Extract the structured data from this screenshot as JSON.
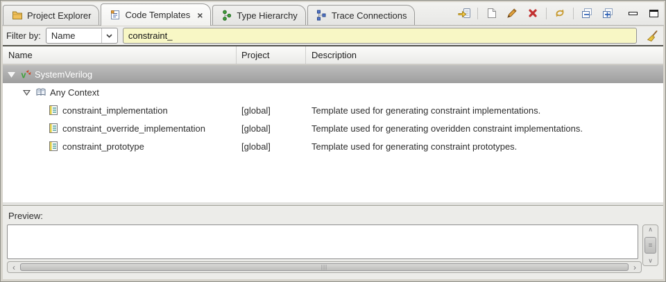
{
  "colors": {
    "filter_input_bg": "#f8f7c5",
    "selection_top": "#bdbdbd",
    "selection_bottom": "#9e9e9e",
    "delete_red": "#c23030",
    "pencil_orange": "#e0a23c",
    "refresh_gold": "#c79a2e",
    "hierarchy_green": "#44a03c",
    "hierarchy_blue": "#5577cc",
    "folder_yellow": "#f0c05a"
  },
  "tabs": {
    "items": [
      {
        "label": "Project Explorer"
      },
      {
        "label": "Code Templates"
      },
      {
        "label": "Type Hierarchy"
      },
      {
        "label": "Trace Connections"
      }
    ]
  },
  "icons": {
    "close": "×",
    "dropdown-chevron": "pointing-down-chevron",
    "folder": "yellow-folder",
    "code-templates": "page-with-lines",
    "type-hierarchy": "green-node-tree",
    "trace-connections": "blue-node-tree",
    "import-template": "page-with-yellow-arrow",
    "new-template": "blank-page",
    "edit-template": "pencil",
    "delete-template": "red-x",
    "refresh": "gold-circular-arrows",
    "collapse-all": "pages-minus",
    "expand-all": "pages-plus",
    "minimize": "bar",
    "maximize": "window-box",
    "clear-filter": "broom",
    "systemverilog": "green-v-red-arrows",
    "any-context": "open-book",
    "template-item": "page-yellow-band",
    "scroll-up": "∧",
    "scroll-down": "∨",
    "scroll-left": "‹",
    "scroll-right": "›",
    "grip-horizontal": "|||",
    "grip-vertical": "≡"
  },
  "filter": {
    "label": "Filter by:",
    "field_value": "Name",
    "query": "constraint_"
  },
  "table": {
    "columns": [
      {
        "label": "Name"
      },
      {
        "label": "Project"
      },
      {
        "label": "Description"
      }
    ],
    "groups": {
      "root": "SystemVerilog",
      "context": "Any Context"
    },
    "rows": [
      {
        "name": "constraint_implementation",
        "project": "[global]",
        "description": "Template used for generating constraint implementations."
      },
      {
        "name": "constraint_override_implementation",
        "project": "[global]",
        "description": "Template used for generating overidden constraint implementations."
      },
      {
        "name": "constraint_prototype",
        "project": "[global]",
        "description": "Template used for generating constraint prototypes."
      }
    ]
  },
  "preview": {
    "label": "Preview:",
    "content": ""
  }
}
